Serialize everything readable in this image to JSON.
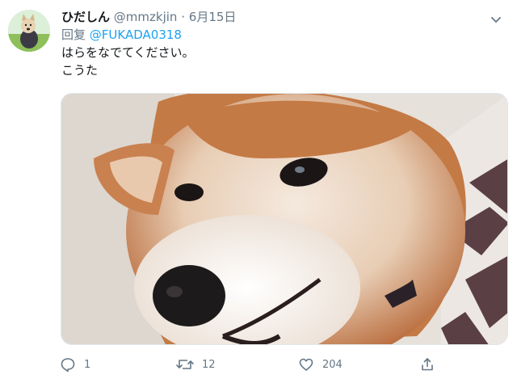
{
  "tweet": {
    "display_name": "ひだしん",
    "handle": "@mmzkjin",
    "separator": "·",
    "date": "6月15日",
    "reply_prefix": "回复",
    "reply_mention": "@FUKADA0318",
    "text_lines": [
      "はらをなでてください。",
      "こうた"
    ],
    "stats": {
      "replies": "1",
      "retweets": "12",
      "likes": "204"
    }
  },
  "colors": {
    "link": "#1da1f2",
    "muted": "#657786",
    "text": "#14171a"
  },
  "icons": {
    "menu": "chevron-down-icon",
    "reply": "reply-icon",
    "retweet": "retweet-icon",
    "like": "heart-icon",
    "share": "share-icon"
  }
}
